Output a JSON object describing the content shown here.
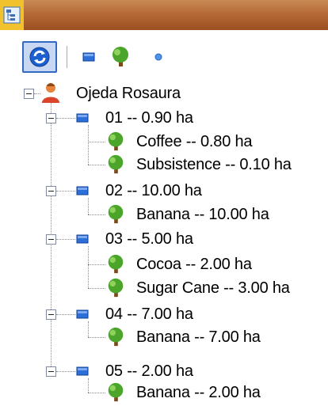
{
  "toolbar": {
    "buttons": [
      {
        "name": "refresh-icon",
        "active": true
      },
      {
        "name": "plot-icon",
        "active": false
      },
      {
        "name": "tree-icon",
        "active": false
      },
      {
        "name": "dot-icon",
        "active": false
      }
    ]
  },
  "tree": {
    "owner": {
      "label": "Ojeda Rosaura",
      "icon": "person-icon"
    },
    "plots": [
      {
        "label": "01 -- 0.90 ha",
        "crops": [
          "Coffee  -- 0.80 ha",
          "Subsistence  -- 0.10 ha"
        ]
      },
      {
        "label": "02 -- 10.00 ha",
        "crops": [
          "Banana  -- 10.00 ha"
        ]
      },
      {
        "label": "03 -- 5.00 ha",
        "crops": [
          "Cocoa  -- 2.00 ha",
          "Sugar Cane  -- 3.00 ha"
        ]
      },
      {
        "label": "04 -- 7.00 ha",
        "crops": [
          "Banana  -- 7.00 ha"
        ]
      },
      {
        "label": "05 -- 2.00 ha",
        "crops": [
          "Banana  -- 2.00 ha"
        ]
      }
    ]
  },
  "colors": {
    "accent": "#3468c6",
    "titlebar": "#b56a36",
    "plot": "#1f5fc8",
    "tree": "#4aa52a"
  }
}
